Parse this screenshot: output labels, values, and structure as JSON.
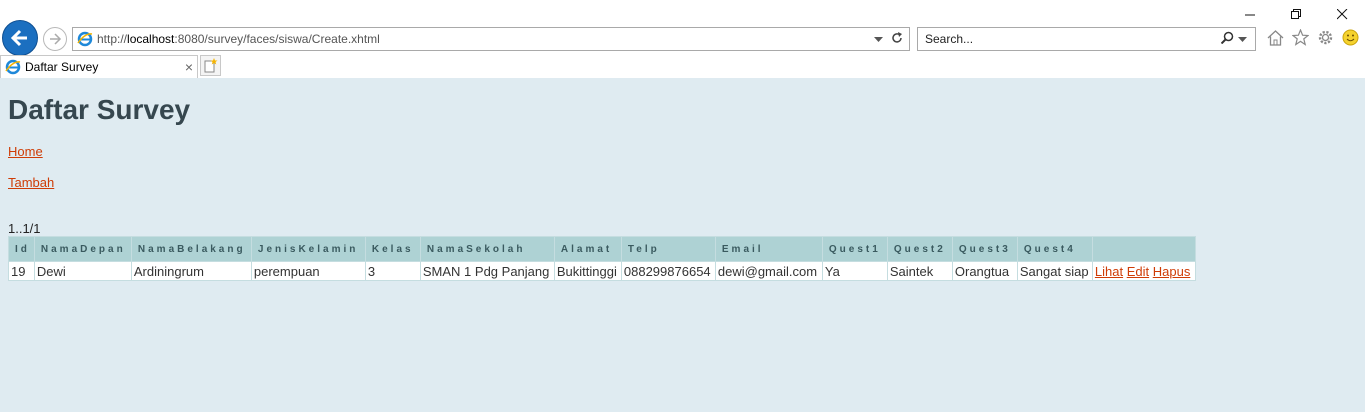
{
  "browser": {
    "address": {
      "prefix": "http://",
      "host": "localhost",
      "rest": ":8080/survey/faces/siswa/Create.xhtml"
    },
    "search_placeholder": "Search...",
    "tab_title": "Daftar Survey",
    "window_controls": [
      "minimize",
      "restore",
      "close"
    ]
  },
  "page": {
    "title": "Daftar Survey",
    "links": {
      "home": "Home",
      "tambah": "Tambah"
    },
    "pager": "1..1/1",
    "table": {
      "headers": [
        "Id",
        "NamaDepan",
        "NamaBelakang",
        "JenisKelamin",
        "Kelas",
        "NamaSekolah",
        "Alamat",
        "Telp",
        "Email",
        "Quest1",
        "Quest2",
        "Quest3",
        "Quest4",
        ""
      ],
      "rows": [
        {
          "cells": [
            "19",
            "Dewi",
            "Ardiningrum",
            "perempuan",
            "3",
            "SMAN 1 Pdg Panjang",
            "Bukittinggi",
            "088299876654",
            "dewi@gmail.com",
            "Ya",
            "Saintek",
            "Orangtua",
            "Sangat siap"
          ],
          "actions": [
            "Lihat",
            "Edit",
            "Hapus"
          ]
        }
      ]
    }
  },
  "colors": {
    "page_bg": "#dfebf1",
    "header_bg": "#aed2d4",
    "link": "#cf3c06",
    "title": "#36474f"
  }
}
